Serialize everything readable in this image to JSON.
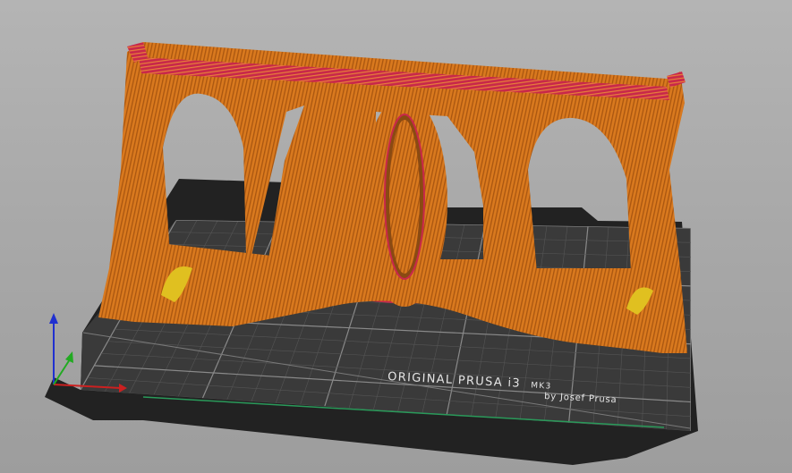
{
  "bed": {
    "logo_line1": "ORIGINAL PRUSA i3",
    "logo_model": "MK3",
    "logo_line2": "by Josef Prusa"
  },
  "colors": {
    "background": "#a9a9a9",
    "bed_surface": "#3a3a3a",
    "bed_frame": "#222222",
    "perimeter": "#d9791e",
    "infill": "#c8284a",
    "support": "#1e9a6b",
    "axis_x": "#cc2020",
    "axis_y": "#22aa22",
    "axis_z": "#2030d0"
  },
  "icons": {
    "axis_gizmo": "xyz-axes-icon"
  }
}
